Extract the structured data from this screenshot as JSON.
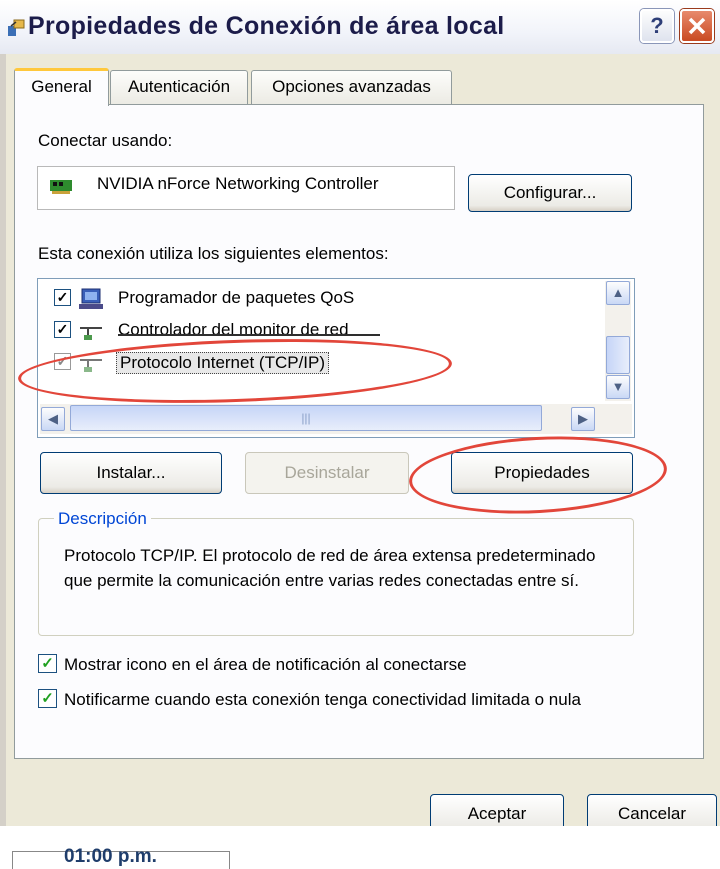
{
  "window": {
    "title": "Propiedades de Conexión de área local",
    "help_label": "?"
  },
  "tabs": [
    {
      "label": "General",
      "active": true
    },
    {
      "label": "Autenticación",
      "active": false
    },
    {
      "label": "Opciones avanzadas",
      "active": false
    }
  ],
  "connect": {
    "label": "Conectar usando:",
    "adapter": "NVIDIA nForce Networking Controller",
    "configure_button": "Configurar..."
  },
  "components": {
    "label": "Esta conexión utiliza los siguientes elementos:",
    "items": [
      {
        "label": "Programador de paquetes QoS",
        "checked": true,
        "icon": "network-scheduler-icon"
      },
      {
        "label": "Controlador del monitor de red",
        "checked": true,
        "icon": "network-protocol-icon"
      },
      {
        "label": "Protocolo Internet (TCP/IP)",
        "checked": true,
        "selected": true,
        "icon": "network-protocol-icon"
      }
    ]
  },
  "buttons": {
    "install": "Instalar...",
    "uninstall": "Desinstalar",
    "properties": "Propiedades",
    "accept": "Aceptar",
    "cancel": "Cancelar"
  },
  "description": {
    "title": "Descripción",
    "text": "Protocolo TCP/IP. El protocolo de red de área extensa predeterminado que permite la comunicación entre varias redes conectadas entre sí."
  },
  "options": [
    {
      "label": "Mostrar icono en el área de notificación al conectarse",
      "checked": true
    },
    {
      "label": "Notificarme cuando esta conexión tenga conectividad limitada o nula",
      "checked": true
    }
  ],
  "taskbar": {
    "clock": "01:00 p.m."
  },
  "colors": {
    "annotation_ring": "#e2463a",
    "dialog_bg": "#ece9d8",
    "active_tab_accent": "#ffc83c",
    "group_title": "#0046d5"
  }
}
